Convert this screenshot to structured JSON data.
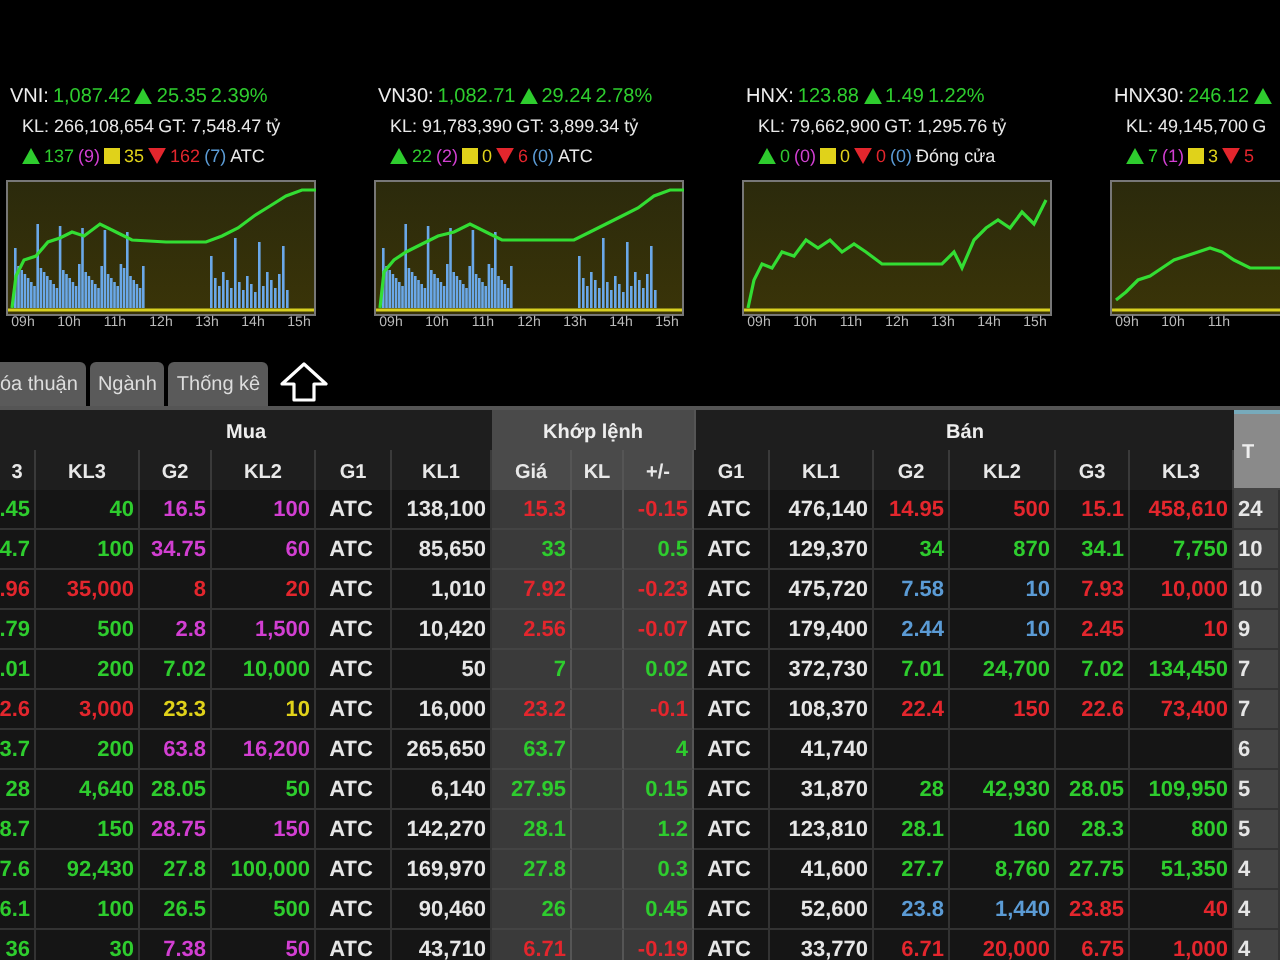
{
  "indices": [
    {
      "name": "VNI:",
      "value": "1,087.42",
      "kind": "up",
      "change": "25.35",
      "percent": "2.39%",
      "volume": "KL: 266,108,654",
      "value_traded": "GT: 7,548.47 tỷ",
      "counts": {
        "up": "137",
        "ceiling": "(9)",
        "unchanged": "35",
        "down": "162",
        "floor": "(7)"
      },
      "session": "ATC",
      "time_labels": [
        "09h",
        "10h",
        "11h",
        "12h",
        "13h",
        "14h",
        "15h"
      ]
    },
    {
      "name": "VN30:",
      "value": "1,082.71",
      "kind": "up",
      "change": "29.24",
      "percent": "2.78%",
      "volume": "KL: 91,783,390",
      "value_traded": "GT: 3,899.34 tỷ",
      "counts": {
        "up": "22",
        "ceiling": "(2)",
        "unchanged": "0",
        "down": "6",
        "floor": "(0)"
      },
      "session": "ATC",
      "time_labels": [
        "09h",
        "10h",
        "11h",
        "12h",
        "13h",
        "14h",
        "15h"
      ]
    },
    {
      "name": "HNX:",
      "value": "123.88",
      "kind": "up",
      "change": "1.49",
      "percent": "1.22%",
      "volume": "KL: 79,662,900",
      "value_traded": "GT: 1,295.76 tỷ",
      "counts": {
        "up": "0",
        "ceiling": "(0)",
        "unchanged": "0",
        "down": "0",
        "floor": "(0)"
      },
      "session": "Đóng cửa",
      "time_labels": [
        "09h",
        "10h",
        "11h",
        "12h",
        "13h",
        "14h",
        "15h"
      ]
    },
    {
      "name": "HNX30:",
      "value": "246.12",
      "kind": "up",
      "volume": "KL: 49,145,700",
      "value_traded": "G",
      "counts": {
        "up": "7",
        "ceiling": "(1)",
        "unchanged": "3",
        "down": "5"
      },
      "time_labels": [
        "09h",
        "10h",
        "11h"
      ]
    }
  ],
  "tabs": [
    {
      "label": "óa thuận",
      "selected": false
    },
    {
      "label": "Ngành",
      "selected": false
    },
    {
      "label": "Thống kê",
      "selected": false
    }
  ],
  "table": {
    "groups": [
      "Mua",
      "Khớp lệnh",
      "Bán"
    ],
    "last_column_header": "T",
    "columns": [
      "3",
      "KL3",
      "G2",
      "KL2",
      "G1",
      "KL1",
      "Giá",
      "KL",
      "+/-",
      "G1",
      "KL1",
      "G2",
      "KL2",
      "G3",
      "KL3"
    ],
    "rows": [
      [
        {
          "text": ".45",
          "kind": "up"
        },
        {
          "text": "40",
          "kind": "up"
        },
        {
          "text": "16.5",
          "kind": "ceiling"
        },
        {
          "text": "100",
          "kind": "ceiling"
        },
        {
          "text": "ATC",
          "kind": "plain"
        },
        {
          "text": "138,100",
          "kind": "plain"
        },
        {
          "text": "15.3",
          "kind": "down"
        },
        {},
        {
          "text": "-0.15",
          "kind": "down"
        },
        {
          "text": "ATC",
          "kind": "plain"
        },
        {
          "text": "476,140",
          "kind": "plain"
        },
        {
          "text": "14.95",
          "kind": "down"
        },
        {
          "text": "500",
          "kind": "down"
        },
        {
          "text": "15.1",
          "kind": "down"
        },
        {
          "text": "458,610",
          "kind": "down"
        },
        {
          "text": "24",
          "kind": "plain"
        }
      ],
      [
        {
          "text": "4.7",
          "kind": "up"
        },
        {
          "text": "100",
          "kind": "up"
        },
        {
          "text": "34.75",
          "kind": "ceiling"
        },
        {
          "text": "60",
          "kind": "ceiling"
        },
        {
          "text": "ATC",
          "kind": "plain"
        },
        {
          "text": "85,650",
          "kind": "plain"
        },
        {
          "text": "33",
          "kind": "up"
        },
        {},
        {
          "text": "0.5",
          "kind": "up"
        },
        {
          "text": "ATC",
          "kind": "plain"
        },
        {
          "text": "129,370",
          "kind": "plain"
        },
        {
          "text": "34",
          "kind": "up"
        },
        {
          "text": "870",
          "kind": "up"
        },
        {
          "text": "34.1",
          "kind": "up"
        },
        {
          "text": "7,750",
          "kind": "up"
        },
        {
          "text": "10",
          "kind": "plain"
        }
      ],
      [
        {
          "text": ".96",
          "kind": "down"
        },
        {
          "text": "35,000",
          "kind": "down"
        },
        {
          "text": "8",
          "kind": "down"
        },
        {
          "text": "20",
          "kind": "down"
        },
        {
          "text": "ATC",
          "kind": "plain"
        },
        {
          "text": "1,010",
          "kind": "plain"
        },
        {
          "text": "7.92",
          "kind": "down"
        },
        {},
        {
          "text": "-0.23",
          "kind": "down"
        },
        {
          "text": "ATC",
          "kind": "plain"
        },
        {
          "text": "475,720",
          "kind": "plain"
        },
        {
          "text": "7.58",
          "kind": "floor"
        },
        {
          "text": "10",
          "kind": "floor"
        },
        {
          "text": "7.93",
          "kind": "down"
        },
        {
          "text": "10,000",
          "kind": "down"
        },
        {
          "text": "10",
          "kind": "plain"
        }
      ],
      [
        {
          "text": ".79",
          "kind": "up"
        },
        {
          "text": "500",
          "kind": "up"
        },
        {
          "text": "2.8",
          "kind": "ceiling"
        },
        {
          "text": "1,500",
          "kind": "ceiling"
        },
        {
          "text": "ATC",
          "kind": "plain"
        },
        {
          "text": "10,420",
          "kind": "plain"
        },
        {
          "text": "2.56",
          "kind": "down"
        },
        {},
        {
          "text": "-0.07",
          "kind": "down"
        },
        {
          "text": "ATC",
          "kind": "plain"
        },
        {
          "text": "179,400",
          "kind": "plain"
        },
        {
          "text": "2.44",
          "kind": "floor"
        },
        {
          "text": "10",
          "kind": "floor"
        },
        {
          "text": "2.45",
          "kind": "down"
        },
        {
          "text": "10",
          "kind": "down"
        },
        {
          "text": "9",
          "kind": "plain"
        }
      ],
      [
        {
          "text": ".01",
          "kind": "up"
        },
        {
          "text": "200",
          "kind": "up"
        },
        {
          "text": "7.02",
          "kind": "up"
        },
        {
          "text": "10,000",
          "kind": "up"
        },
        {
          "text": "ATC",
          "kind": "plain"
        },
        {
          "text": "50",
          "kind": "plain"
        },
        {
          "text": "7",
          "kind": "up"
        },
        {},
        {
          "text": "0.02",
          "kind": "up"
        },
        {
          "text": "ATC",
          "kind": "plain"
        },
        {
          "text": "372,730",
          "kind": "plain"
        },
        {
          "text": "7.01",
          "kind": "up"
        },
        {
          "text": "24,700",
          "kind": "up"
        },
        {
          "text": "7.02",
          "kind": "up"
        },
        {
          "text": "134,450",
          "kind": "up"
        },
        {
          "text": "7",
          "kind": "plain"
        }
      ],
      [
        {
          "text": "2.6",
          "kind": "down"
        },
        {
          "text": "3,000",
          "kind": "down"
        },
        {
          "text": "23.3",
          "kind": "reference"
        },
        {
          "text": "10",
          "kind": "reference"
        },
        {
          "text": "ATC",
          "kind": "plain"
        },
        {
          "text": "16,000",
          "kind": "plain"
        },
        {
          "text": "23.2",
          "kind": "down"
        },
        {},
        {
          "text": "-0.1",
          "kind": "down"
        },
        {
          "text": "ATC",
          "kind": "plain"
        },
        {
          "text": "108,370",
          "kind": "plain"
        },
        {
          "text": "22.4",
          "kind": "down"
        },
        {
          "text": "150",
          "kind": "down"
        },
        {
          "text": "22.6",
          "kind": "down"
        },
        {
          "text": "73,400",
          "kind": "down"
        },
        {
          "text": "7",
          "kind": "plain"
        }
      ],
      [
        {
          "text": "3.7",
          "kind": "up"
        },
        {
          "text": "200",
          "kind": "up"
        },
        {
          "text": "63.8",
          "kind": "ceiling"
        },
        {
          "text": "16,200",
          "kind": "ceiling"
        },
        {
          "text": "ATC",
          "kind": "plain"
        },
        {
          "text": "265,650",
          "kind": "plain"
        },
        {
          "text": "63.7",
          "kind": "up"
        },
        {},
        {
          "text": "4",
          "kind": "up"
        },
        {
          "text": "ATC",
          "kind": "plain"
        },
        {
          "text": "41,740",
          "kind": "plain"
        },
        {},
        {},
        {},
        {},
        {
          "text": "6",
          "kind": "plain"
        }
      ],
      [
        {
          "text": "28",
          "kind": "up"
        },
        {
          "text": "4,640",
          "kind": "up"
        },
        {
          "text": "28.05",
          "kind": "up"
        },
        {
          "text": "50",
          "kind": "up"
        },
        {
          "text": "ATC",
          "kind": "plain"
        },
        {
          "text": "6,140",
          "kind": "plain"
        },
        {
          "text": "27.95",
          "kind": "up"
        },
        {},
        {
          "text": "0.15",
          "kind": "up"
        },
        {
          "text": "ATC",
          "kind": "plain"
        },
        {
          "text": "31,870",
          "kind": "plain"
        },
        {
          "text": "28",
          "kind": "up"
        },
        {
          "text": "42,930",
          "kind": "up"
        },
        {
          "text": "28.05",
          "kind": "up"
        },
        {
          "text": "109,950",
          "kind": "up"
        },
        {
          "text": "5",
          "kind": "plain"
        }
      ],
      [
        {
          "text": "8.7",
          "kind": "up"
        },
        {
          "text": "150",
          "kind": "up"
        },
        {
          "text": "28.75",
          "kind": "ceiling"
        },
        {
          "text": "150",
          "kind": "ceiling"
        },
        {
          "text": "ATC",
          "kind": "plain"
        },
        {
          "text": "142,270",
          "kind": "plain"
        },
        {
          "text": "28.1",
          "kind": "up"
        },
        {},
        {
          "text": "1.2",
          "kind": "up"
        },
        {
          "text": "ATC",
          "kind": "plain"
        },
        {
          "text": "123,810",
          "kind": "plain"
        },
        {
          "text": "28.1",
          "kind": "up"
        },
        {
          "text": "160",
          "kind": "up"
        },
        {
          "text": "28.3",
          "kind": "up"
        },
        {
          "text": "800",
          "kind": "up"
        },
        {
          "text": "5",
          "kind": "plain"
        }
      ],
      [
        {
          "text": "7.6",
          "kind": "up"
        },
        {
          "text": "92,430",
          "kind": "up"
        },
        {
          "text": "27.8",
          "kind": "up"
        },
        {
          "text": "100,000",
          "kind": "up"
        },
        {
          "text": "ATC",
          "kind": "plain"
        },
        {
          "text": "169,970",
          "kind": "plain"
        },
        {
          "text": "27.8",
          "kind": "up"
        },
        {},
        {
          "text": "0.3",
          "kind": "up"
        },
        {
          "text": "ATC",
          "kind": "plain"
        },
        {
          "text": "41,600",
          "kind": "plain"
        },
        {
          "text": "27.7",
          "kind": "up"
        },
        {
          "text": "8,760",
          "kind": "up"
        },
        {
          "text": "27.75",
          "kind": "up"
        },
        {
          "text": "51,350",
          "kind": "up"
        },
        {
          "text": "4",
          "kind": "plain"
        }
      ],
      [
        {
          "text": "6.1",
          "kind": "up"
        },
        {
          "text": "100",
          "kind": "up"
        },
        {
          "text": "26.5",
          "kind": "up"
        },
        {
          "text": "500",
          "kind": "up"
        },
        {
          "text": "ATC",
          "kind": "plain"
        },
        {
          "text": "90,460",
          "kind": "plain"
        },
        {
          "text": "26",
          "kind": "up"
        },
        {},
        {
          "text": "0.45",
          "kind": "up"
        },
        {
          "text": "ATC",
          "kind": "plain"
        },
        {
          "text": "52,600",
          "kind": "plain"
        },
        {
          "text": "23.8",
          "kind": "floor"
        },
        {
          "text": "1,440",
          "kind": "floor"
        },
        {
          "text": "23.85",
          "kind": "down"
        },
        {
          "text": "40",
          "kind": "down"
        },
        {
          "text": "4",
          "kind": "plain"
        }
      ],
      [
        {
          "text": "36",
          "kind": "up"
        },
        {
          "text": "30",
          "kind": "up"
        },
        {
          "text": "7.38",
          "kind": "ceiling"
        },
        {
          "text": "50",
          "kind": "ceiling"
        },
        {
          "text": "ATC",
          "kind": "plain"
        },
        {
          "text": "43,710",
          "kind": "plain"
        },
        {
          "text": "6.71",
          "kind": "down"
        },
        {},
        {
          "text": "-0.19",
          "kind": "down"
        },
        {
          "text": "ATC",
          "kind": "plain"
        },
        {
          "text": "33,770",
          "kind": "plain"
        },
        {
          "text": "6.71",
          "kind": "down"
        },
        {
          "text": "20,000",
          "kind": "down"
        },
        {
          "text": "6.75",
          "kind": "down"
        },
        {
          "text": "1,000",
          "kind": "down"
        },
        {
          "text": "4",
          "kind": "plain"
        }
      ]
    ]
  }
}
